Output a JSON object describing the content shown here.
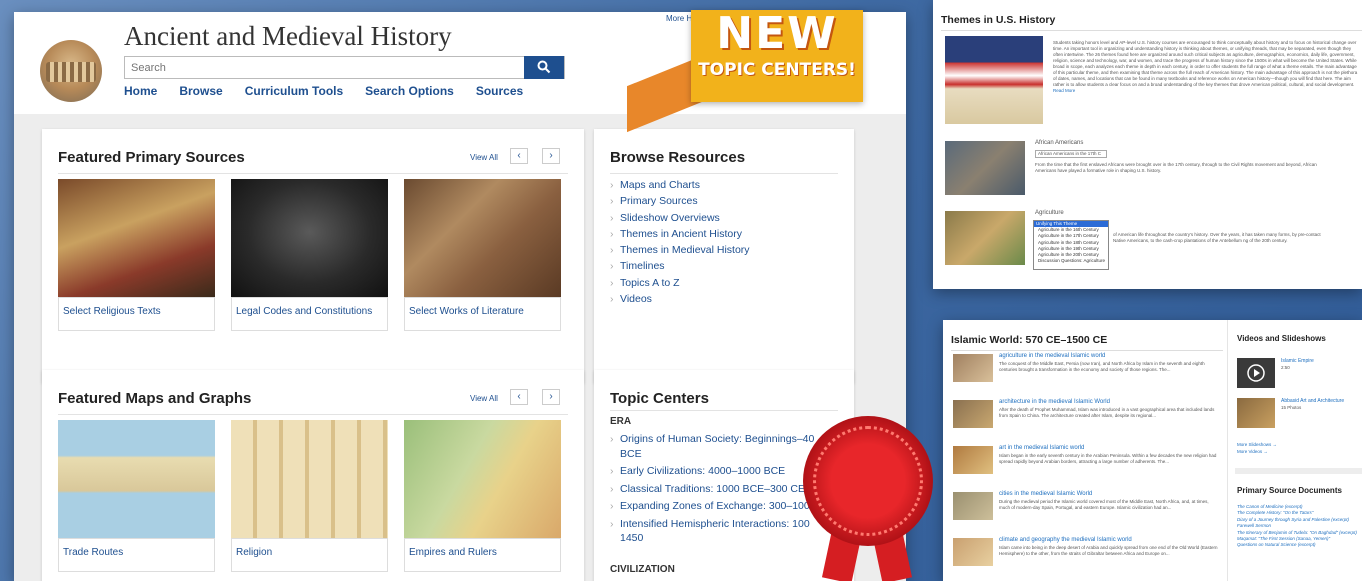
{
  "site": {
    "title": "Ancient and Medieval History",
    "more_link": "More H",
    "search_placeholder": "Search",
    "nav": [
      "Home",
      "Browse",
      "Curriculum Tools",
      "Search Options",
      "Sources"
    ]
  },
  "banner": {
    "line1": "NEW",
    "line2": "TOPIC CENTERS!"
  },
  "primary_sources": {
    "title": "Featured Primary Sources",
    "view_all": "View All",
    "items": [
      "Select Religious Texts",
      "Legal Codes and Constitutions",
      "Select Works of Literature"
    ]
  },
  "browse": {
    "title": "Browse Resources",
    "items": [
      "Maps and Charts",
      "Primary Sources",
      "Slideshow Overviews",
      "Themes in Ancient History",
      "Themes in Medieval History",
      "Timelines",
      "Topics A to Z",
      "Videos"
    ]
  },
  "maps": {
    "title": "Featured Maps and Graphs",
    "view_all": "View All",
    "items": [
      "Trade Routes",
      "Religion",
      "Empires and Rulers"
    ]
  },
  "topics": {
    "title": "Topic Centers",
    "era_label": "ERA",
    "eras": [
      "Origins of Human Society: Beginnings–40 BCE",
      "Early Civilizations: 4000–1000 BCE",
      "Classical Traditions: 1000 BCE–300 CE",
      "Expanding Zones of Exchange: 300–100",
      "Intensified Hemispheric Interactions: 100 1450"
    ],
    "civ_label": "CIVILIZATION"
  },
  "us_history": {
    "title": "Themes in U.S. History",
    "intro": "Students taking honors level and AP-level U.S. history courses are encouraged to think conceptually about history and to focus on historical change over time. An important tool in organizing and understanding history is thinking about themes, or unifying threads, that may be separated, even though they often intertwine. The 26 themes found here are organized around such critical subjects as agriculture, demographics, economics, daily life, government, religion, science and technology, war, and women, and trace the progress of human history since the 1500s in what will become the United States. While broad in scope, each analyzes each theme in depth in each century, in order to offer students the full range of what a theme entails. The main advantage of this particular theme, and then examining that theme across the full reach of American history. The main advantage of this approach is not the plethora of dates, names, and locations that can be found in many textbooks and reference works on American history—though you will find that here. The aim rather is to allow students a clear focus on and a broad understanding of the key themes that drove American political, cultural, and social development.",
    "read_more": "Read More",
    "af_title": "African Americans",
    "af_select": "African Americans in the 17th C",
    "af_text": "From the time that the first enslaved Africans were brought over in the 17th century, through to the Civil Rights movement and beyond, African Americans have played a formative role in shaping U.S. history.",
    "ag_title": "Agriculture",
    "ag_options": [
      "Unifying This Theme",
      "Agriculture in the 16th Century",
      "Agriculture in the 17th Century",
      "Agriculture in the 18th Century",
      "Agriculture in the 19th Century",
      "Agriculture in the 20th Century",
      "Discussion Questions: Agriculture"
    ],
    "ag_text": "of American life throughout the country's history. Over the years, it has taken many forms, by pre-contact Native Americans, to the cash-crop plantations of the Antebellum ng of the 20th century."
  },
  "islamic": {
    "title": "Islamic World: 570 CE–1500 CE",
    "entries": [
      {
        "title": "agriculture in the medieval Islamic world",
        "text": "The conquest of the Middle East, Persia (now Iran), and North Africa by Islam in the seventh and eighth centuries brought a transformation in the economy and society of those regions. The..."
      },
      {
        "title": "architecture in the medieval Islamic World",
        "text": "After the death of Prophet Muhammad, Islam was introduced in a vast geographical area that included lands from Spain to China. The architecture created after Islam, despite its regional..."
      },
      {
        "title": "art in the medieval Islamic world",
        "text": "Islam began in the early seventh century in the Arabian Peninsula. Within a few decades the new religion had spread rapidly beyond Arabian borders, attracting a large number of adherents. The..."
      },
      {
        "title": "cities in the medieval Islamic World",
        "text": "During the medieval period the Islamic world covered most of the Middle East, North Africa, and, at times, much of modern-day Spain, Portugal, and eastern Europe. Islamic civilization had an..."
      },
      {
        "title": "climate and geography the medieval Islamic world",
        "text": "Islam came into being in the deep desert of Arabia and quickly spread from one end of the Old World (Eastern Hemisphere) to the other, from the straits of Gibraltar between Africa and Europe on..."
      }
    ],
    "videos_title": "Videos and Slideshows",
    "video1_title": "Islamic Empire",
    "video1_meta": "2:50",
    "video2_title": "Abbasid Art and Architecture",
    "video2_meta": "15 Photos",
    "more_slideshows": "More Slideshows →",
    "more_videos": "More Videos →",
    "psd_title": "Primary Source Documents",
    "psd_items": [
      "The Canon of Medicine (excerpt)",
      "The Complete History: \"On the Tatars\"",
      "Diary of a Journey through Syria and Palestine (excerpt)",
      "Farewell Sermon",
      "The Itinerary of Benjamin of Tudela: \"On Baghdad\" (excerpt)",
      "Maqamat: \"The First Session (Sanaa, Yemen)\"",
      "Questions on Natural Science (excerpt)"
    ]
  },
  "colors": {
    "brand": "#1e4f8f",
    "banner": "#f2b21b",
    "rosette": "#e8262a"
  }
}
